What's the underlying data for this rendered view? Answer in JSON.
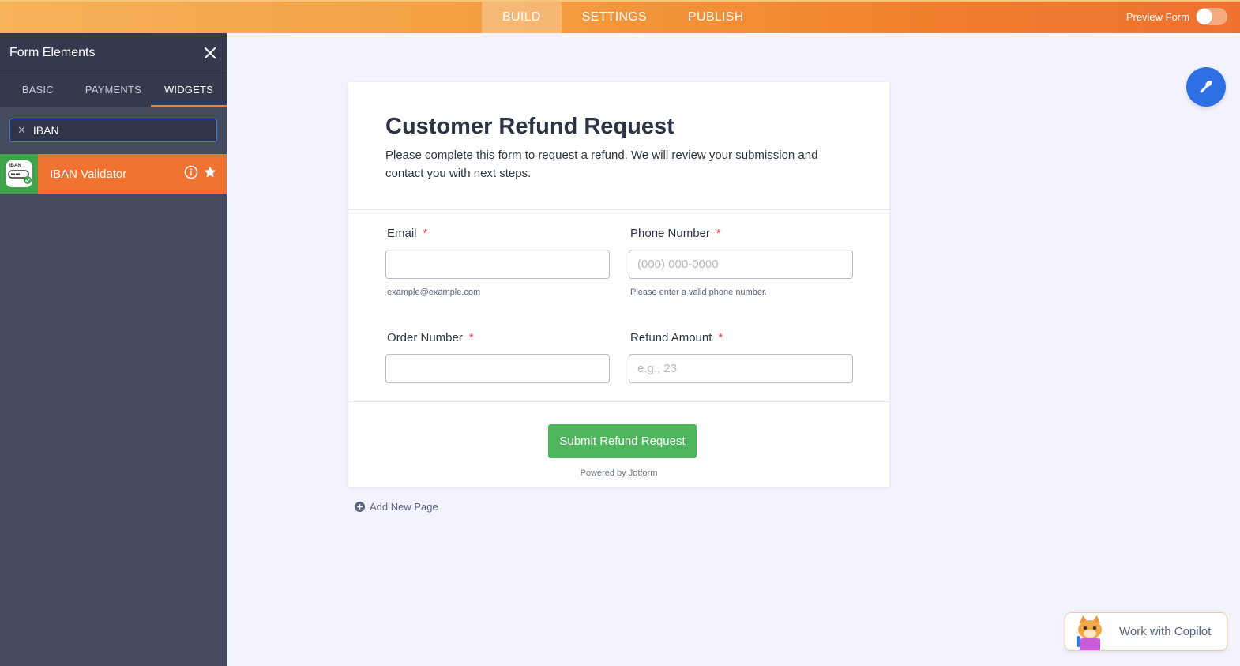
{
  "topbar": {
    "tabs": [
      {
        "label": "BUILD",
        "active": true
      },
      {
        "label": "SETTINGS",
        "active": false
      },
      {
        "label": "PUBLISH",
        "active": false
      }
    ],
    "preview_label": "Preview Form",
    "preview_enabled": false
  },
  "sidebar": {
    "title": "Form Elements",
    "tabs": [
      {
        "label": "BASIC",
        "active": false
      },
      {
        "label": "PAYMENTS",
        "active": false
      },
      {
        "label": "WIDGETS",
        "active": true
      }
    ],
    "search": {
      "value": "IBAN",
      "placeholder": ""
    },
    "results": [
      {
        "label": "IBAN Validator",
        "icon_text": "IBAN",
        "icon": "iban-validator-icon"
      }
    ]
  },
  "form": {
    "title": "Customer Refund Request",
    "description": "Please complete this form to request a refund. We will review your submission and contact you with next steps.",
    "fields": {
      "email": {
        "label": "Email",
        "required_mark": "*",
        "placeholder": "",
        "help": "example@example.com"
      },
      "phone": {
        "label": "Phone Number",
        "required_mark": "*",
        "placeholder": "(000) 000-0000",
        "help": "Please enter a valid phone number."
      },
      "order": {
        "label": "Order Number",
        "required_mark": "*",
        "placeholder": ""
      },
      "refund": {
        "label": "Refund Amount",
        "required_mark": "*",
        "placeholder": "e.g., 23"
      }
    },
    "submit_label": "Submit Refund Request",
    "powered_by": "Powered by Jotform"
  },
  "add_page_label": "Add New Page",
  "copilot_label": "Work with Copilot",
  "colors": {
    "accent_orange": "#ef7230",
    "submit_green": "#4fb55d",
    "fab_blue": "#2f6fe4",
    "sidebar_bg": "#454b5f",
    "required_red": "#f23a3c"
  }
}
